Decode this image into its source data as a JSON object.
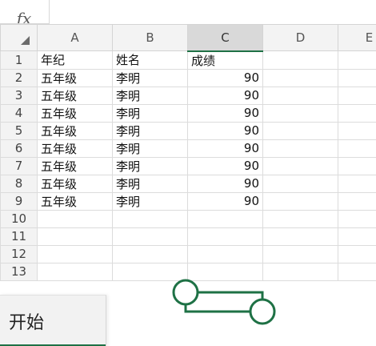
{
  "formula_bar": {
    "fx_label": "fx",
    "value": ""
  },
  "columns": [
    "A",
    "B",
    "C",
    "D",
    "E"
  ],
  "rows": [
    {
      "n": "1",
      "a": "年纪",
      "b": "姓名",
      "c": "成绩"
    },
    {
      "n": "2",
      "a": "五年级",
      "b": "李明",
      "c": "90"
    },
    {
      "n": "3",
      "a": "五年级",
      "b": "李明",
      "c": "90"
    },
    {
      "n": "4",
      "a": "五年级",
      "b": "李明",
      "c": "90"
    },
    {
      "n": "5",
      "a": "五年级",
      "b": "李明",
      "c": "90"
    },
    {
      "n": "6",
      "a": "五年级",
      "b": "李明",
      "c": "90"
    },
    {
      "n": "7",
      "a": "五年级",
      "b": "李明",
      "c": "90"
    },
    {
      "n": "8",
      "a": "五年级",
      "b": "李明",
      "c": "90"
    },
    {
      "n": "9",
      "a": "五年级",
      "b": "李明",
      "c": "90"
    },
    {
      "n": "10",
      "a": "",
      "b": "",
      "c": ""
    },
    {
      "n": "11",
      "a": "",
      "b": "",
      "c": ""
    },
    {
      "n": "12",
      "a": "",
      "b": "",
      "c": ""
    },
    {
      "n": "13",
      "a": "",
      "b": "",
      "c": ""
    }
  ],
  "selected_column": "C",
  "start_popup": {
    "label": "开始"
  },
  "colors": {
    "accent": "#1e7145",
    "header_bg": "#f3f3f3",
    "selected_header_bg": "#d9d9d9",
    "gridline": "#dcdcdc"
  }
}
